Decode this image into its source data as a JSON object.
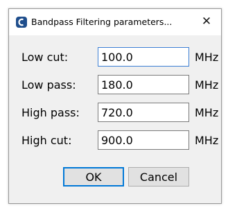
{
  "window": {
    "title": "Bandpass Filtering parameters...",
    "close_glyph": "✕"
  },
  "fields": [
    {
      "label": "Low cut:",
      "value": "100.0",
      "unit": "MHz"
    },
    {
      "label": "Low pass:",
      "value": "180.0",
      "unit": "MHz"
    },
    {
      "label": "High pass:",
      "value": "720.0",
      "unit": "MHz"
    },
    {
      "label": "High cut:",
      "value": "900.0",
      "unit": "MHz"
    }
  ],
  "buttons": {
    "ok": "OK",
    "cancel": "Cancel"
  },
  "colors": {
    "focus_border": "#3c7fd4",
    "default_button_border": "#0078d7",
    "app_icon": "#1f4e8c"
  }
}
